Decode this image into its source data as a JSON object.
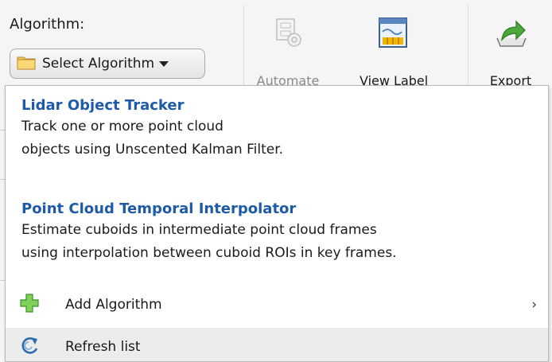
{
  "toolbar": {
    "algorithm_label": "Algorithm:",
    "select_button_label": "Select Algorithm",
    "automate_label": "Automate",
    "view_label_label": "View Label",
    "export_label": "Export"
  },
  "dropdown": {
    "algorithms": [
      {
        "title": "Lidar Object Tracker",
        "description_lines": [
          "Track one or more point cloud",
          "objects using Unscented Kalman Filter."
        ]
      },
      {
        "title": "Point Cloud Temporal Interpolator",
        "description_lines": [
          "Estimate cuboids in intermediate point cloud frames",
          "using interpolation between cuboid ROIs in key frames."
        ]
      }
    ],
    "add_algorithm_label": "Add Algorithm",
    "add_algorithm_arrow": "›",
    "refresh_label": "Refresh list"
  },
  "icons": {
    "folder": "folder-icon",
    "automate": "automate-icon",
    "view_label": "view-label-icon",
    "export": "export-icon",
    "add": "plus-icon",
    "refresh": "refresh-icon"
  },
  "colors": {
    "title_blue": "#1e5aa8",
    "add_green": "#6cc24a",
    "refresh_blue": "#2b6cb0",
    "hover_row": "#ececec"
  }
}
